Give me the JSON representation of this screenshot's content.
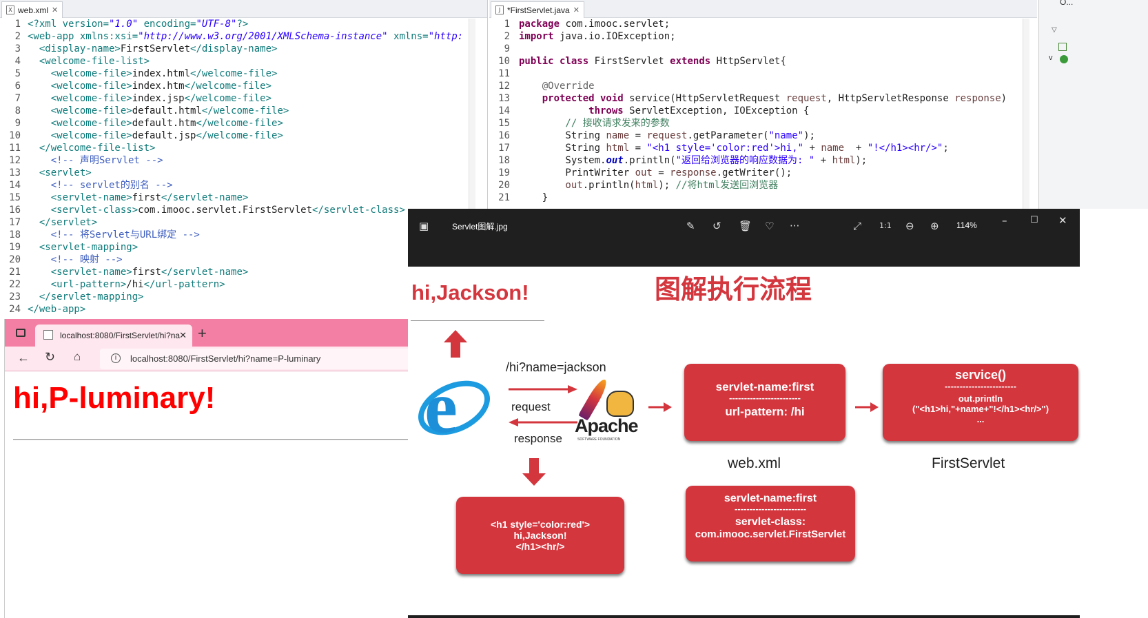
{
  "left_editor": {
    "tab": "web.xml",
    "lines": [
      {
        "n": "1",
        "segs": [
          [
            "c",
            "<?xml version="
          ],
          [
            "v",
            "\"1.0\""
          ],
          [
            "c",
            " encoding="
          ],
          [
            "v",
            "\"UTF-8\""
          ],
          [
            "c",
            "?>"
          ]
        ]
      },
      {
        "n": "2",
        "segs": [
          [
            "c",
            "<web-app xmlns:xsi="
          ],
          [
            "v",
            "\"http://www.w3.org/2001/XMLSchema-instance\""
          ],
          [
            "c",
            " xmlns="
          ],
          [
            "v",
            "\"http:"
          ]
        ]
      },
      {
        "n": "3",
        "segs": [
          [
            "c",
            "  <display-name>"
          ],
          [
            "t",
            "FirstServlet"
          ],
          [
            "c",
            "</display-name>"
          ]
        ]
      },
      {
        "n": "4",
        "segs": [
          [
            "c",
            "  <welcome-file-list>"
          ]
        ]
      },
      {
        "n": "5",
        "segs": [
          [
            "c",
            "    <welcome-file>"
          ],
          [
            "t",
            "index.html"
          ],
          [
            "c",
            "</welcome-file>"
          ]
        ]
      },
      {
        "n": "6",
        "segs": [
          [
            "c",
            "    <welcome-file>"
          ],
          [
            "t",
            "index.htm"
          ],
          [
            "c",
            "</welcome-file>"
          ]
        ]
      },
      {
        "n": "7",
        "segs": [
          [
            "c",
            "    <welcome-file>"
          ],
          [
            "t",
            "index.jsp"
          ],
          [
            "c",
            "</welcome-file>"
          ]
        ]
      },
      {
        "n": "8",
        "segs": [
          [
            "c",
            "    <welcome-file>"
          ],
          [
            "t",
            "default.html"
          ],
          [
            "c",
            "</welcome-file>"
          ]
        ]
      },
      {
        "n": "9",
        "segs": [
          [
            "c",
            "    <welcome-file>"
          ],
          [
            "t",
            "default.htm"
          ],
          [
            "c",
            "</welcome-file>"
          ]
        ]
      },
      {
        "n": "10",
        "segs": [
          [
            "c",
            "    <welcome-file>"
          ],
          [
            "t",
            "default.jsp"
          ],
          [
            "c",
            "</welcome-file>"
          ]
        ]
      },
      {
        "n": "11",
        "segs": [
          [
            "c",
            "  </welcome-file-list>"
          ]
        ]
      },
      {
        "n": "12",
        "segs": [
          [
            "m",
            "    <!-- 声明Servlet -->"
          ]
        ]
      },
      {
        "n": "13",
        "segs": [
          [
            "c",
            "  <servlet>"
          ]
        ]
      },
      {
        "n": "14",
        "segs": [
          [
            "m",
            "    <!-- servlet的别名 -->"
          ]
        ]
      },
      {
        "n": "15",
        "segs": [
          [
            "c",
            "    <servlet-name>"
          ],
          [
            "t",
            "first"
          ],
          [
            "c",
            "</servlet-name>"
          ]
        ]
      },
      {
        "n": "16",
        "segs": [
          [
            "c",
            "    <servlet-class>"
          ],
          [
            "t",
            "com.imooc.servlet.FirstServlet"
          ],
          [
            "c",
            "</servlet-class>"
          ]
        ]
      },
      {
        "n": "17",
        "segs": [
          [
            "c",
            "  </servlet>"
          ]
        ]
      },
      {
        "n": "18",
        "segs": [
          [
            "m",
            "    <!-- 将Servlet与URL绑定 -->"
          ]
        ]
      },
      {
        "n": "19",
        "segs": [
          [
            "c",
            "  <servlet-mapping>"
          ]
        ]
      },
      {
        "n": "20",
        "segs": [
          [
            "m",
            "    <!-- 映射 -->"
          ]
        ]
      },
      {
        "n": "21",
        "segs": [
          [
            "c",
            "    <servlet-name>"
          ],
          [
            "t",
            "first"
          ],
          [
            "c",
            "</servlet-name>"
          ]
        ]
      },
      {
        "n": "22",
        "segs": [
          [
            "c",
            "    <url-pattern>"
          ],
          [
            "t",
            "/hi"
          ],
          [
            "c",
            "</url-pattern>"
          ]
        ]
      },
      {
        "n": "23",
        "segs": [
          [
            "c",
            "  </servlet-mapping>"
          ]
        ]
      },
      {
        "n": "24",
        "segs": [
          [
            "c",
            "</web-app>"
          ]
        ]
      }
    ]
  },
  "right_editor": {
    "tab": "*FirstServlet.java",
    "lines": [
      {
        "n": "1",
        "segs": [
          [
            "k",
            "package"
          ],
          [
            "t",
            " com.imooc.servlet;"
          ]
        ]
      },
      {
        "n": "2",
        "segs": [
          [
            "k",
            "import"
          ],
          [
            "t",
            " java.io.IOException;"
          ]
        ]
      },
      {
        "n": "9",
        "segs": []
      },
      {
        "n": "10",
        "segs": [
          [
            "k",
            "public class"
          ],
          [
            "t",
            " FirstServlet "
          ],
          [
            "k",
            "extends"
          ],
          [
            "t",
            " HttpServlet{"
          ]
        ]
      },
      {
        "n": "11",
        "segs": []
      },
      {
        "n": "12",
        "segs": [
          [
            "a",
            "    @Override"
          ]
        ]
      },
      {
        "n": "13",
        "segs": [
          [
            "k",
            "    protected void"
          ],
          [
            "t",
            " service(HttpServletRequest "
          ],
          [
            "r",
            "request"
          ],
          [
            "t",
            ", HttpServletResponse "
          ],
          [
            "r",
            "response"
          ],
          [
            "t",
            ")"
          ]
        ]
      },
      {
        "n": "14",
        "segs": [
          [
            "k",
            "            throws"
          ],
          [
            "t",
            " ServletException, IOException {"
          ]
        ]
      },
      {
        "n": "15",
        "segs": [
          [
            "g",
            "        // 接收请求发来的参数"
          ]
        ]
      },
      {
        "n": "16",
        "segs": [
          [
            "t",
            "        String "
          ],
          [
            "r",
            "name"
          ],
          [
            "t",
            " = "
          ],
          [
            "r",
            "request"
          ],
          [
            "t",
            ".getParameter("
          ],
          [
            "s",
            "\"name\""
          ],
          [
            "t",
            ");"
          ]
        ]
      },
      {
        "n": "17",
        "segs": [
          [
            "t",
            "        String "
          ],
          [
            "r",
            "html"
          ],
          [
            "t",
            " = "
          ],
          [
            "s",
            "\"<h1 style='color:red'>hi,\""
          ],
          [
            "t",
            " + "
          ],
          [
            "r",
            "name"
          ],
          [
            "t",
            "  + "
          ],
          [
            "s",
            "\"!</h1><hr/>\""
          ],
          [
            "t",
            ";"
          ]
        ]
      },
      {
        "n": "18",
        "segs": [
          [
            "t",
            "        System."
          ],
          [
            "o",
            "out"
          ],
          [
            "t",
            ".println("
          ],
          [
            "s",
            "\"返回给浏览器的响应数据为: \""
          ],
          [
            "t",
            " + "
          ],
          [
            "r",
            "html"
          ],
          [
            "t",
            ");"
          ]
        ]
      },
      {
        "n": "19",
        "segs": [
          [
            "t",
            "        PrintWriter "
          ],
          [
            "r",
            "out"
          ],
          [
            "t",
            " = "
          ],
          [
            "r",
            "response"
          ],
          [
            "t",
            ".getWriter();"
          ]
        ]
      },
      {
        "n": "20",
        "segs": [
          [
            "r",
            "        out"
          ],
          [
            "t",
            ".println("
          ],
          [
            "r",
            "html"
          ],
          [
            "t",
            "); "
          ],
          [
            "g",
            "//将html发送回浏览器"
          ]
        ]
      },
      {
        "n": "21",
        "segs": [
          [
            "t",
            "    }"
          ]
        ]
      }
    ]
  },
  "browser": {
    "tab_title": "localhost:8080/FirstServlet/hi?na",
    "new_tab": "+",
    "url": "localhost:8080/FirstServlet/hi?name=P-luminary",
    "heading": "hi,P-luminary!"
  },
  "viewer": {
    "filename": "Servlet图解.jpg",
    "zoom": "114%",
    "slide": {
      "title": "图解执行流程",
      "result": "hi,Jackson!",
      "url_label": "/hi?name=jackson",
      "request": "request",
      "response": "response",
      "apache": "Apache",
      "apache_sub": "SOFTWARE FOUNDATION",
      "box1_a": "servlet-name:first",
      "box1_b": "url-pattern: /hi",
      "box1_caption": "web.xml",
      "box2_a": "service()",
      "box2_b": "out.println",
      "box2_c": "(\"<h1>hi,\"+name+\"!</h1><hr/>\")",
      "box2_d": "...",
      "box2_caption": "FirstServlet",
      "box3_a": "<h1 style='color:red'>",
      "box3_b": "hi,Jackson!",
      "box3_c": "</h1><hr/>",
      "box4_a": "servlet-name:first",
      "box4_b": "servlet-class:",
      "box4_c": "com.imooc.servlet.FirstServlet",
      "dashes": "------------------------"
    }
  },
  "outline": {
    "label": "O..."
  },
  "colors": {
    "accent_red": "#d4363e",
    "browser_pink": "#f47fa4",
    "heading_red": "#ff0000"
  }
}
